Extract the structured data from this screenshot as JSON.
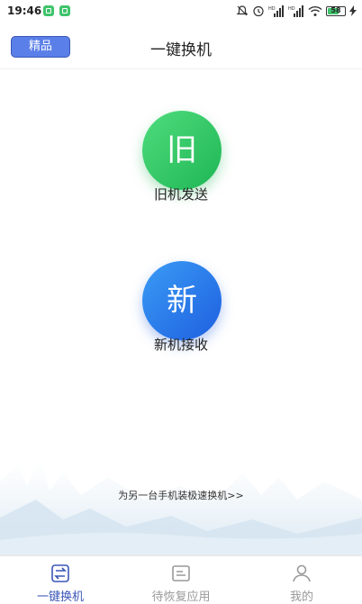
{
  "status_bar": {
    "time": "19:46",
    "battery": "58",
    "icons": [
      "app-notification-icon",
      "app-notification-icon",
      "mute-icon",
      "alarm-icon",
      "signal-icon",
      "signal-icon",
      "wifi-icon",
      "battery-icon",
      "charging-icon"
    ]
  },
  "header": {
    "premium_button": "精品",
    "title": "一键换机"
  },
  "actions": {
    "old": {
      "glyph": "旧",
      "label": "旧机发送",
      "color": "#2cc462"
    },
    "new": {
      "glyph": "新",
      "label": "新机接收",
      "color": "#2a76ec"
    }
  },
  "link": "为另一台手机装极速换机>>",
  "tabs": [
    {
      "label": "一键换机",
      "icon": "phone-switch-icon",
      "active": true
    },
    {
      "label": "待恢复应用",
      "icon": "restore-apps-icon",
      "active": false
    },
    {
      "label": "我的",
      "icon": "user-icon",
      "active": false
    }
  ],
  "colors": {
    "accent": "#3a56b8",
    "inactive": "#999999"
  }
}
